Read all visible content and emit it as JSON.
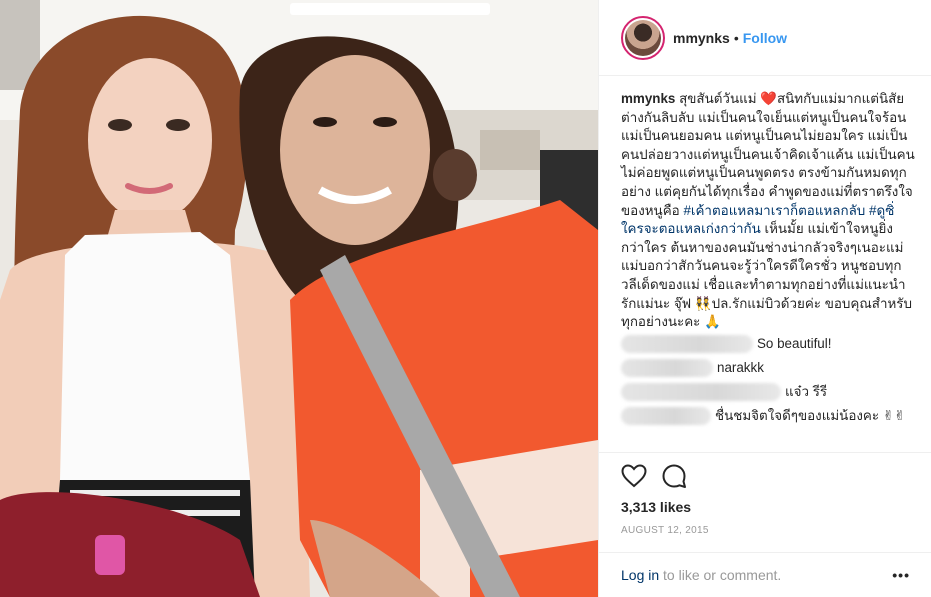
{
  "post": {
    "username": "mmynks",
    "separator": "•",
    "follow_label": "Follow",
    "caption": {
      "username": "mmynks",
      "part1": "สุขสันต์วันแม่",
      "heart": "❤️",
      "part2": "สนิทกับแม่มากแต่นิสัยต่างกันลิบลับ แม่เป็นคนใจเย็นแต่หนูเป็นคนใจร้อน แม่เป็นคนยอมคน แต่หนูเป็นคนไม่ยอมใคร แม่เป็นคนปล่อยวางแต่หนูเป็นคนเจ้าคิดเจ้าแค้น แม่เป็นคนไม่ค่อยพูดแต่หนูเป็นคนพูดตรง ตรงข้ามกันหมดทุกอย่าง แต่คุยกันได้ทุกเรื่อง คำพูดของแม่ที่ตราตรึงใจของหนูคือ",
      "tag1": "#เค้าตอแหลมาเราก็ตอแหลกลับ",
      "tag2": "#ดูซิ่ใครจะตอแหลเก่งกว่ากัน",
      "part3": "เห็นมั้ย แม่เข้าใจหนูยิ่งกว่าใคร ต้นหาของคนมันช่างน่ากลัวจริงๆเนอะแม่ แม่บอกว่าสักวันคนจะรู้ว่าใครดีใครชั่ว หนูชอบทุกวลีเด็ดของแม่ เชื่อและทำตามทุกอย่างที่แม่แนะนำ รักแม่นะ จุ๊ฟ",
      "emoji_girls": "👯",
      "part4": "ปล.รักแม่บิวด้วยค่ะ ขอบคุณสำหรับทุกอย่างนะคะ",
      "emoji_pray": "🙏"
    },
    "comments": [
      {
        "text": "So beautiful!"
      },
      {
        "text": "narakkk"
      },
      {
        "text": "แจ๋ว รีรี"
      },
      {
        "text": "ชื่นชมจิตใจดีๆของแม่น้องคะ ✌✌"
      }
    ],
    "likes": "3,313 likes",
    "date": "AUGUST 12, 2015",
    "login_label": "Log in",
    "login_suffix": " to like or comment.",
    "more_label": "•••"
  },
  "icons": {
    "like": "heart-icon",
    "comment": "comment-icon",
    "more": "more-options-icon"
  },
  "colors": {
    "follow": "#3897f0",
    "hashtag": "#003569",
    "avatar_ring": "#d4246f",
    "muted": "#999999",
    "heart": "#e0245e"
  }
}
